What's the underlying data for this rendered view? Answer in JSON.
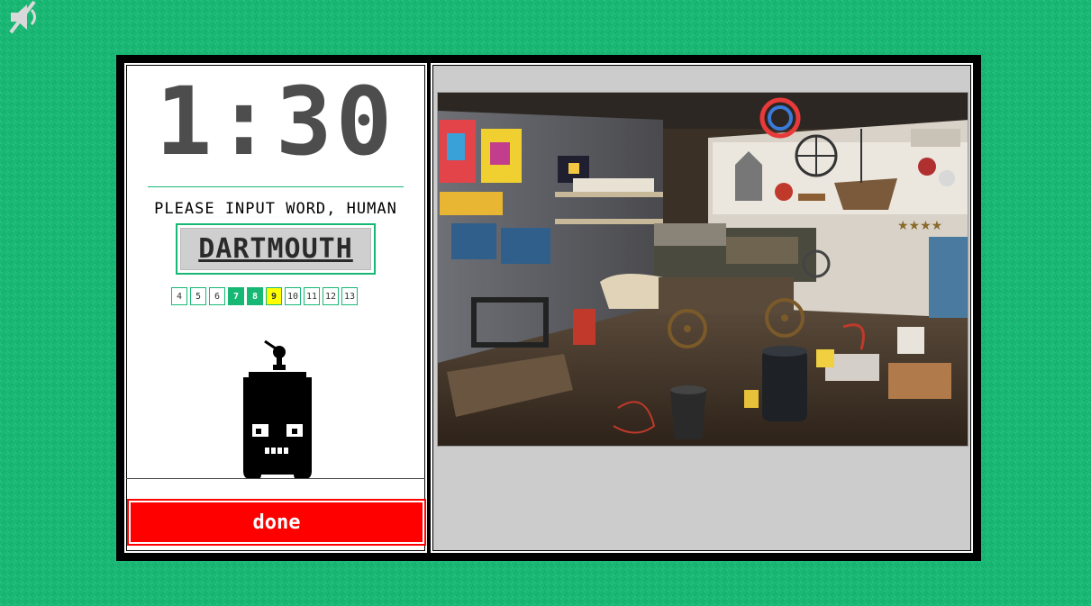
{
  "timer": {
    "value": "1:30"
  },
  "prompt": {
    "text": "PLEASE INPUT WORD, HUMAN"
  },
  "word": {
    "value": "DARTMOUTH"
  },
  "lengths": [
    {
      "label": "4",
      "state": "normal"
    },
    {
      "label": "5",
      "state": "normal"
    },
    {
      "label": "6",
      "state": "normal"
    },
    {
      "label": "7",
      "state": "active"
    },
    {
      "label": "8",
      "state": "active"
    },
    {
      "label": "9",
      "state": "current"
    },
    {
      "label": "10",
      "state": "normal"
    },
    {
      "label": "11",
      "state": "normal"
    },
    {
      "label": "12",
      "state": "normal"
    },
    {
      "label": "13",
      "state": "normal"
    }
  ],
  "done_button": {
    "label": "done"
  },
  "icons": {
    "mute": "speaker-muted-icon",
    "robot": "robot-icon"
  },
  "colors": {
    "background": "#17b874",
    "accent": "#17b874",
    "current_length": "#ffff00",
    "done_button": "#ff0000",
    "timer_text": "#4d4d4d"
  }
}
